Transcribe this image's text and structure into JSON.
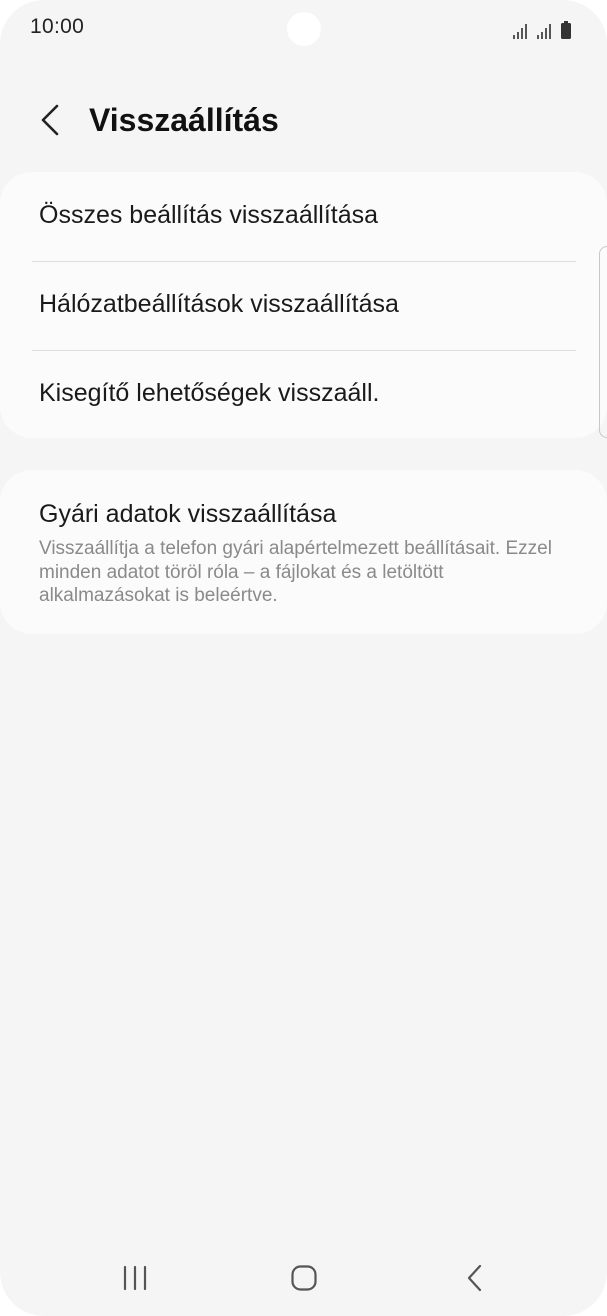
{
  "status_bar": {
    "time": "10:00",
    "icons": [
      "signal-icon",
      "signal-icon",
      "battery-icon"
    ]
  },
  "header": {
    "back_icon": "chevron-left-icon",
    "title": "Visszaállítás"
  },
  "reset_options": [
    {
      "label": "Összes beállítás visszaállítása"
    },
    {
      "label": "Hálózatbeállítások visszaállítása"
    },
    {
      "label": "Kisegítő lehetőségek visszaáll."
    }
  ],
  "factory_reset": {
    "title": "Gyári adatok visszaállítása",
    "description": "Visszaállítja a telefon gyári alapértelmezett beállításait. Ezzel minden adatot töröl róla – a fájlokat és a letöltött alkalmazásokat is beleértve."
  },
  "navigation_bar": {
    "buttons": [
      "recents-icon",
      "home-icon",
      "back-icon"
    ]
  },
  "colors": {
    "background": "#f5f5f5",
    "card": "#fbfbfb",
    "primary_text": "#1a1a1a",
    "secondary_text": "#8a8a8a",
    "divider": "#dddddd"
  }
}
